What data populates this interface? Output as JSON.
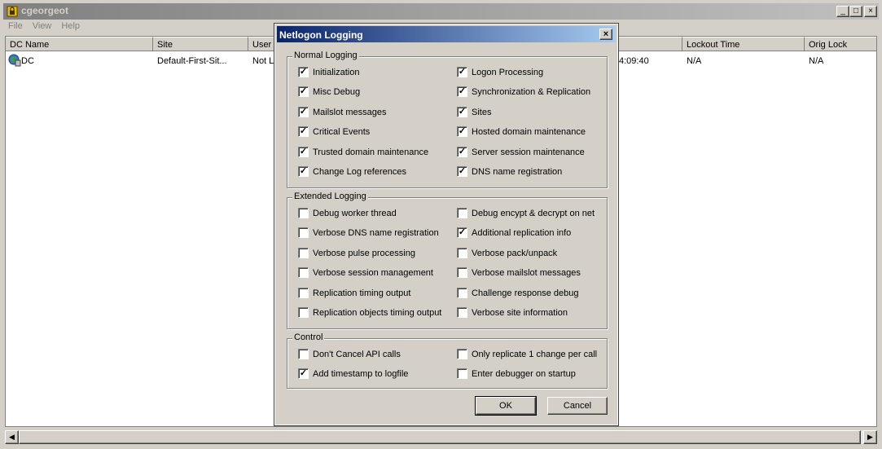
{
  "window": {
    "title": "cgeorgeot",
    "minimize": "_",
    "maximize": "□",
    "close": "×"
  },
  "menu": [
    "File",
    "View",
    "Help"
  ],
  "columns": [
    "DC Name",
    "Site",
    "User S",
    "Lockout Time",
    "Orig Lock"
  ],
  "row": {
    "dc_name": "DC",
    "site": "Default-First-Sit...",
    "user_state": "Not Lo",
    "time_fragment": "4:09:40",
    "lockout_time": "N/A",
    "orig_lock": "N/A"
  },
  "dialog": {
    "title": "Netlogon Logging",
    "close": "×",
    "normal": {
      "legend": "Normal Logging",
      "items": [
        {
          "label": "Initialization",
          "checked": true
        },
        {
          "label": "Logon Processing",
          "checked": true
        },
        {
          "label": "Misc Debug",
          "checked": true
        },
        {
          "label": "Synchronization & Replication",
          "checked": true
        },
        {
          "label": "Mailslot messages",
          "checked": true
        },
        {
          "label": "Sites",
          "checked": true
        },
        {
          "label": "Critical Events",
          "checked": true
        },
        {
          "label": "Hosted domain maintenance",
          "checked": true
        },
        {
          "label": "Trusted domain maintenance",
          "checked": true
        },
        {
          "label": "Server session maintenance",
          "checked": true
        },
        {
          "label": "Change Log references",
          "checked": true
        },
        {
          "label": "DNS name registration",
          "checked": true
        }
      ]
    },
    "extended": {
      "legend": "Extended Logging",
      "items": [
        {
          "label": "Debug worker thread",
          "checked": false
        },
        {
          "label": "Debug encypt & decrypt on net",
          "checked": false
        },
        {
          "label": "Verbose DNS name registration",
          "checked": false
        },
        {
          "label": "Additional replication info",
          "checked": true
        },
        {
          "label": "Verbose pulse processing",
          "checked": false
        },
        {
          "label": "Verbose pack/unpack",
          "checked": false
        },
        {
          "label": "Verbose session management",
          "checked": false
        },
        {
          "label": "Verbose mailslot messages",
          "checked": false
        },
        {
          "label": "Replication timing output",
          "checked": false
        },
        {
          "label": "Challenge response debug",
          "checked": false
        },
        {
          "label": "Replication objects timing output",
          "checked": false
        },
        {
          "label": "Verbose site information",
          "checked": false
        }
      ]
    },
    "control": {
      "legend": "Control",
      "items": [
        {
          "label": "Don't Cancel API calls",
          "checked": false
        },
        {
          "label": "Only replicate 1 change per call",
          "checked": false
        },
        {
          "label": "Add timestamp to logfile",
          "checked": true
        },
        {
          "label": "Enter debugger on startup",
          "checked": false
        }
      ]
    },
    "ok": "OK",
    "cancel": "Cancel"
  }
}
